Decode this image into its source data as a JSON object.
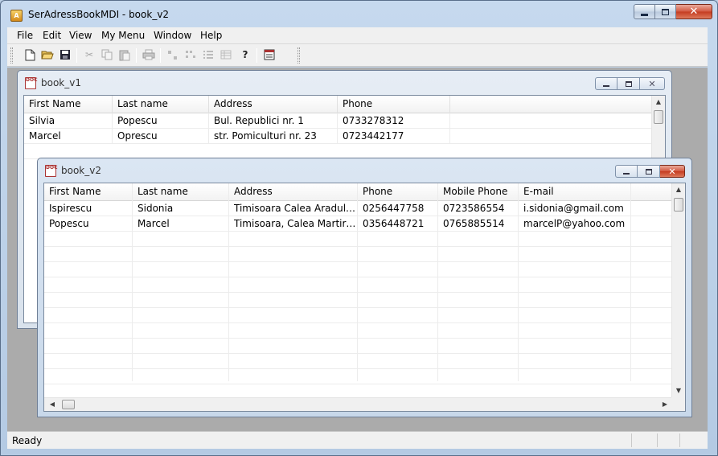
{
  "app": {
    "title": "SerAdressBookMDI - book_v2",
    "icon": "address-book-icon"
  },
  "menu": {
    "items": [
      "File",
      "Edit",
      "View",
      "My Menu",
      "Window",
      "Help"
    ]
  },
  "toolbar": {
    "buttons": [
      "new-icon",
      "open-icon",
      "save-icon",
      "cut-icon",
      "copy-icon",
      "paste-icon",
      "print-icon",
      "large-icons-icon",
      "small-icons-icon",
      "list-icon",
      "details-icon",
      "help-icon",
      "table-icon"
    ]
  },
  "status": {
    "text": "Ready"
  },
  "book_v1": {
    "title": "book_v1",
    "columns": [
      "First Name",
      "Last name",
      "Address",
      "Phone"
    ],
    "rows": [
      [
        "Silvia",
        "Popescu",
        "Bul. Republici nr. 1",
        "0733278312"
      ],
      [
        "Marcel",
        "Oprescu",
        "str. Pomiculturi nr. 23",
        "0723442177"
      ]
    ]
  },
  "book_v2": {
    "title": "book_v2",
    "columns": [
      "First Name",
      "Last name",
      "Address",
      "Phone",
      "Mobile Phone",
      "E-mail"
    ],
    "rows": [
      [
        "Ispirescu",
        "Sidonia",
        "Timisoara Calea Aradului ...",
        "0256447758",
        "0723586554",
        "i.sidonia@gmail.com"
      ],
      [
        "Popescu",
        "Marcel",
        "Timisoara, Calea Martirilor...",
        "0356448721",
        "0765885514",
        "marcelP@yahoo.com"
      ]
    ]
  }
}
